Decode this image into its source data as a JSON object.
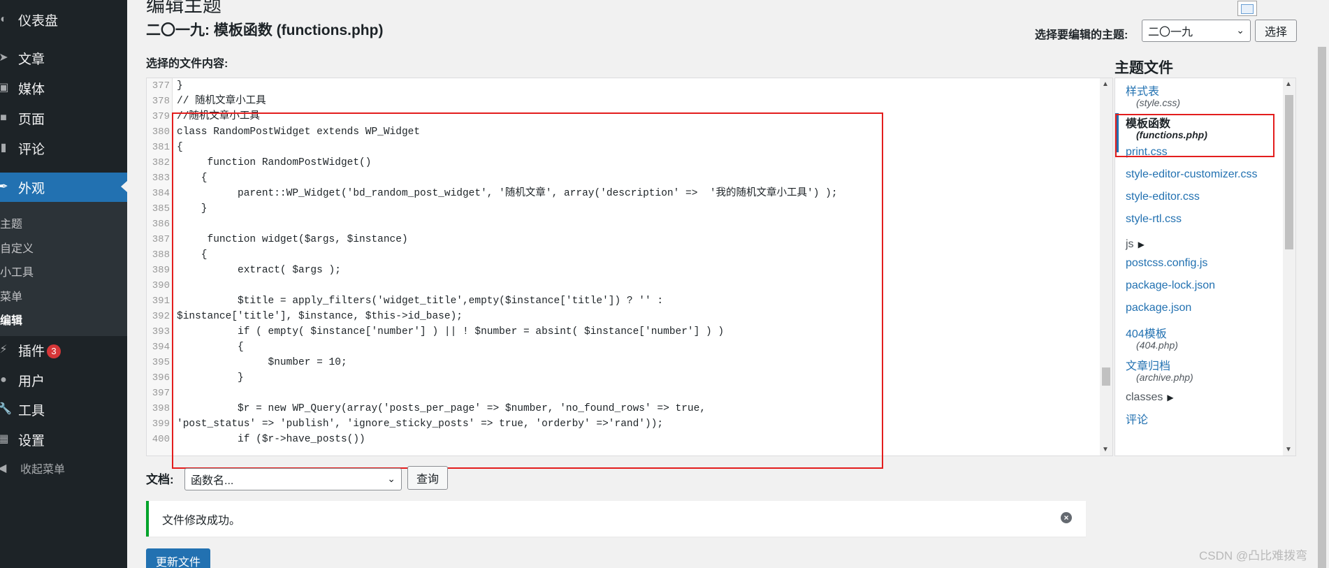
{
  "sidebar": {
    "items": [
      {
        "label": "仪表盘",
        "icon": "dashboard-icon"
      },
      {
        "label": "文章",
        "icon": "pin-icon"
      },
      {
        "label": "媒体",
        "icon": "media-icon"
      },
      {
        "label": "页面",
        "icon": "page-icon"
      },
      {
        "label": "评论",
        "icon": "comment-icon"
      },
      {
        "label": "外观",
        "icon": "appearance-icon"
      },
      {
        "label": "插件",
        "icon": "plugin-icon",
        "badge": "3"
      },
      {
        "label": "用户",
        "icon": "users-icon"
      },
      {
        "label": "工具",
        "icon": "tools-icon"
      },
      {
        "label": "设置",
        "icon": "settings-icon"
      }
    ],
    "submenu": [
      "主题",
      "自定义",
      "小工具",
      "菜单",
      "编辑"
    ],
    "collapse_label": "收起菜单"
  },
  "page": {
    "heading": "编辑主题",
    "file_title": "二〇一九: 模板函数 (functions.php)",
    "theme_select_label": "选择要编辑的主题:",
    "theme_select_value": "二〇一九",
    "select_button": "选择",
    "content_label": "选择的文件内容:"
  },
  "editor": {
    "lines": [
      {
        "n": "377",
        "text": "}"
      },
      {
        "n": "378",
        "text": "// 随机文章小工具"
      },
      {
        "n": "379",
        "text": "//随机文章小工具"
      },
      {
        "n": "380",
        "text": "class RandomPostWidget extends WP_Widget"
      },
      {
        "n": "381",
        "text": "{"
      },
      {
        "n": "382",
        "text": "     function RandomPostWidget()"
      },
      {
        "n": "383",
        "text": "    {"
      },
      {
        "n": "384",
        "text": "          parent::WP_Widget('bd_random_post_widget', '随机文章', array('description' =>  '我的随机文章小工具') );"
      },
      {
        "n": "385",
        "text": "    }"
      },
      {
        "n": "386",
        "text": ""
      },
      {
        "n": "387",
        "text": "     function widget($args, $instance)"
      },
      {
        "n": "388",
        "text": "    {"
      },
      {
        "n": "389",
        "text": "          extract( $args );"
      },
      {
        "n": "390",
        "text": ""
      },
      {
        "n": "391",
        "text": "          $title = apply_filters('widget_title',empty($instance['title']) ? '' :"
      },
      {
        "n": "392",
        "text": "$instance['title'], $instance, $this->id_base);"
      },
      {
        "n": "393",
        "text": "          if ( empty( $instance['number'] ) || ! $number = absint( $instance['number'] ) )"
      },
      {
        "n": "394",
        "text": "          {"
      },
      {
        "n": "395",
        "text": "               $number = 10;"
      },
      {
        "n": "396",
        "text": "          }"
      },
      {
        "n": "397",
        "text": ""
      },
      {
        "n": "398",
        "text": "          $r = new WP_Query(array('posts_per_page' => $number, 'no_found_rows' => true,"
      },
      {
        "n": "399",
        "text": "'post_status' => 'publish', 'ignore_sticky_posts' => true, 'orderby' =>'rand'));"
      },
      {
        "n": "400",
        "text": "          if ($r->have_posts())"
      }
    ]
  },
  "files": {
    "heading": "主题文件",
    "entries": [
      {
        "kind": "file",
        "label": "样式表",
        "sub": "(style.css)"
      },
      {
        "kind": "file",
        "label": "模板函数",
        "sub": "(functions.php)",
        "selected": true
      },
      {
        "kind": "file",
        "label": "print.css"
      },
      {
        "kind": "file",
        "label": "style-editor-customizer.css"
      },
      {
        "kind": "file",
        "label": "style-editor.css"
      },
      {
        "kind": "file",
        "label": "style-rtl.css"
      },
      {
        "kind": "folder",
        "label": "js"
      },
      {
        "kind": "file",
        "label": "postcss.config.js"
      },
      {
        "kind": "file",
        "label": "package-lock.json"
      },
      {
        "kind": "file",
        "label": "package.json"
      },
      {
        "kind": "file",
        "label": "404模板",
        "sub": "(404.php)"
      },
      {
        "kind": "file",
        "label": "文章归档",
        "sub": "(archive.php)"
      },
      {
        "kind": "folder",
        "label": "classes"
      },
      {
        "kind": "file",
        "label": "评论"
      }
    ]
  },
  "docs": {
    "label": "文档:",
    "select_placeholder": "函数名...",
    "lookup_button": "查询"
  },
  "notice": {
    "text": "文件修改成功。"
  },
  "update_button": "更新文件",
  "watermark": "CSDN @凸比难拨弯",
  "colors": {
    "admin_bg": "#1d2327",
    "accent": "#2271b1",
    "highlight_box": "#e31d1d",
    "success": "#00a32a"
  }
}
